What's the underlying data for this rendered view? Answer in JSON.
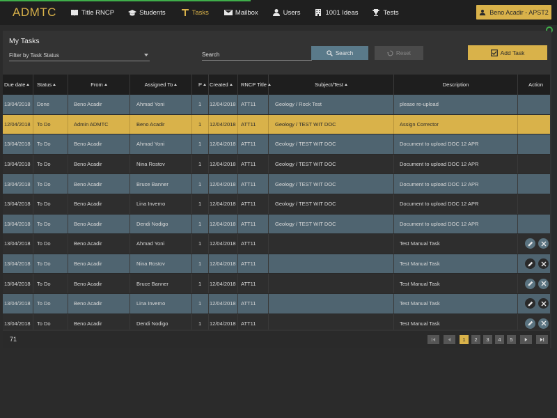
{
  "nav": {
    "brand": "ADMTC",
    "items": [
      {
        "label": "Title RNCP",
        "icon": "book-icon"
      },
      {
        "label": "Students",
        "icon": "graduation-cap-icon"
      },
      {
        "label": "Tasks",
        "icon": "tasks-icon",
        "active": true
      },
      {
        "label": "Mailbox",
        "icon": "envelope-icon"
      },
      {
        "label": "Users",
        "icon": "user-icon"
      },
      {
        "label": "1001 Ideas",
        "icon": "building-icon"
      },
      {
        "label": "Tests",
        "icon": "trophy-icon"
      }
    ],
    "user_label": "Beno Acadir - APST2"
  },
  "panel": {
    "title": "My Tasks",
    "filter_placeholder": "Filter by Task Status",
    "search_placeholder": "Search",
    "search_button": "Search",
    "reset_button": "Reset",
    "add_button": "Add Task"
  },
  "table": {
    "headers": {
      "due": "Due date",
      "status": "Status",
      "from": "From",
      "assigned": "Assigned To",
      "p": "P",
      "created": "Created",
      "rncp": "RNCP Title",
      "subject": "Subject/Test",
      "desc": "Description",
      "action": "Action"
    },
    "rows": [
      {
        "due": "13/04/2018",
        "status": "Done",
        "from": "Beno Acadir",
        "assigned": "Ahmad Yoni",
        "p": "1",
        "created": "12/04/2018",
        "rncp": "ATT11",
        "subject": "Geology / Rock Test",
        "desc": "please re-upload",
        "actions": false
      },
      {
        "due": "12/04/2018",
        "status": "To Do",
        "from": "Admin ADMTC",
        "assigned": "Beno Acadir",
        "p": "1",
        "created": "12/04/2018",
        "rncp": "ATT11",
        "subject": "Geology / TEST WIT DOC",
        "desc": "Assign Corrector",
        "actions": false,
        "selected": true
      },
      {
        "due": "13/04/2018",
        "status": "To Do",
        "from": "Beno Acadir",
        "assigned": "Ahmad Yoni",
        "p": "1",
        "created": "12/04/2018",
        "rncp": "ATT11",
        "subject": "Geology / TEST WIT DOC",
        "desc": "Document to upload DOC 12 APR",
        "actions": false
      },
      {
        "due": "13/04/2018",
        "status": "To Do",
        "from": "Beno Acadir",
        "assigned": "Nina Rostov",
        "p": "1",
        "created": "12/04/2018",
        "rncp": "ATT11",
        "subject": "Geology / TEST WIT DOC",
        "desc": "Document to upload DOC 12 APR",
        "actions": false
      },
      {
        "due": "13/04/2018",
        "status": "To Do",
        "from": "Beno Acadir",
        "assigned": "Bruce Banner",
        "p": "1",
        "created": "12/04/2018",
        "rncp": "ATT11",
        "subject": "Geology / TEST WIT DOC",
        "desc": "Document to upload DOC 12 APR",
        "actions": false
      },
      {
        "due": "13/04/2018",
        "status": "To Do",
        "from": "Beno Acadir",
        "assigned": "Lina Inverno",
        "p": "1",
        "created": "12/04/2018",
        "rncp": "ATT11",
        "subject": "Geology / TEST WIT DOC",
        "desc": "Document to upload DOC 12 APR",
        "actions": false
      },
      {
        "due": "13/04/2018",
        "status": "To Do",
        "from": "Beno Acadir",
        "assigned": "Dendi Nodigo",
        "p": "1",
        "created": "12/04/2018",
        "rncp": "ATT11",
        "subject": "Geology / TEST WIT DOC",
        "desc": "Document to upload DOC 12 APR",
        "actions": false
      },
      {
        "due": "13/04/2018",
        "status": "To Do",
        "from": "Beno Acadir",
        "assigned": "Ahmad Yoni",
        "p": "1",
        "created": "12/04/2018",
        "rncp": "ATT11",
        "subject": "",
        "desc": "Test Manual Task",
        "actions": true
      },
      {
        "due": "13/04/2018",
        "status": "To Do",
        "from": "Beno Acadir",
        "assigned": "Nina Rostov",
        "p": "1",
        "created": "12/04/2018",
        "rncp": "ATT11",
        "subject": "",
        "desc": "Test Manual Task",
        "actions": true
      },
      {
        "due": "13/04/2018",
        "status": "To Do",
        "from": "Beno Acadir",
        "assigned": "Bruce Banner",
        "p": "1",
        "created": "12/04/2018",
        "rncp": "ATT11",
        "subject": "",
        "desc": "Test Manual Task",
        "actions": true
      },
      {
        "due": "13/04/2018",
        "status": "To Do",
        "from": "Beno Acadir",
        "assigned": "Lina Inverno",
        "p": "1",
        "created": "12/04/2018",
        "rncp": "ATT11",
        "subject": "",
        "desc": "Test Manual Task",
        "actions": true
      },
      {
        "due": "13/04/2018",
        "status": "To Do",
        "from": "Beno Acadir",
        "assigned": "Dendi Nodigo",
        "p": "1",
        "created": "12/04/2018",
        "rncp": "ATT11",
        "subject": "",
        "desc": "Test Manual Task",
        "actions": true
      }
    ]
  },
  "footer": {
    "count": "71",
    "pages": [
      "1",
      "2",
      "3",
      "4",
      "5"
    ],
    "current_page": "1"
  },
  "colors": {
    "accent": "#d9b24a",
    "teal_row": "#4f6470",
    "dark_row": "#2e2e2e",
    "nav_bg": "#1f1f1f"
  }
}
